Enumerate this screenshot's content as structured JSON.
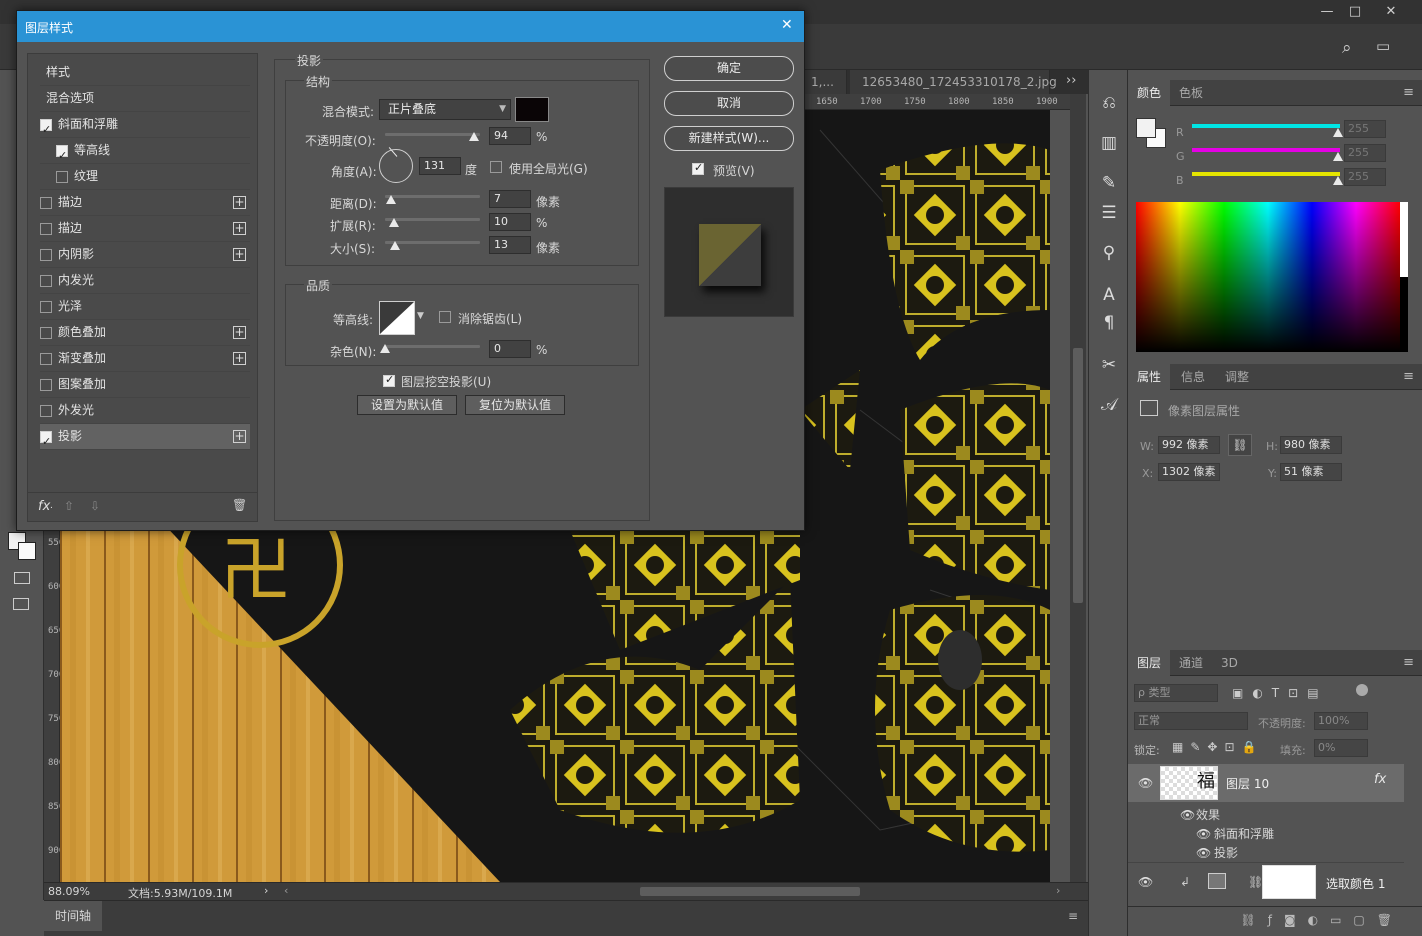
{
  "window": {
    "minimize": "—",
    "maximize": "□",
    "close": "✕",
    "search_icon": "⌕",
    "arrange_icon": "▭"
  },
  "doc": {
    "tabs": [
      "1,...",
      "12653480_172453310178_2.jpg"
    ],
    "tab_overflow": "››",
    "ruler_ticks": [
      "1650",
      "1700",
      "1750",
      "1800",
      "1850",
      "1900"
    ],
    "vruler_ticks": [
      "550",
      "600",
      "650",
      "700",
      "750",
      "800",
      "850",
      "900"
    ],
    "zoom": "88.09%",
    "doc_size": "文档:5.93M/109.1M",
    "status_arrow": "›",
    "scroll_left": "‹",
    "scroll_right": "›"
  },
  "timeline": {
    "label": "时间轴",
    "menu": "≡"
  },
  "color_panel": {
    "tabs": [
      "颜色",
      "色板"
    ],
    "menu": "≡",
    "channels": [
      {
        "name": "R",
        "value": "255",
        "color": "#00e5e5"
      },
      {
        "name": "G",
        "value": "255",
        "color": "#e500e5"
      },
      {
        "name": "B",
        "value": "255",
        "color": "#e5e500"
      }
    ]
  },
  "properties_panel": {
    "tabs": [
      "属性",
      "信息",
      "调整"
    ],
    "menu": "≡",
    "subtitle": "像素图层属性",
    "w_label": "W:",
    "w_value": "992 像素",
    "h_label": "H:",
    "h_value": "980 像素",
    "x_label": "X:",
    "x_value": "1302 像素",
    "y_label": "Y:",
    "y_value": "51 像素",
    "link_icon": "⛓"
  },
  "layers_panel": {
    "tabs": [
      "图层",
      "通道",
      "3D"
    ],
    "menu": "≡",
    "filter_label": "ρ 类型",
    "blend_mode": "正常",
    "opacity_label": "不透明度:",
    "opacity_value": "100%",
    "lock_label": "锁定:",
    "fill_label": "填充:",
    "fill_value": "0%",
    "layers": [
      {
        "name": "图层 10",
        "fx": "fx"
      },
      {
        "name": "选取颜色 1"
      }
    ],
    "effects_label": "效果",
    "effects": [
      "斜面和浮雕",
      "投影"
    ],
    "thumb_glyph": "福"
  },
  "dialog": {
    "title": "图层样式",
    "close": "✕",
    "styles": [
      {
        "label": "样式",
        "check": null,
        "plus": false,
        "indent": false
      },
      {
        "label": "混合选项",
        "check": null,
        "plus": false,
        "indent": false
      },
      {
        "label": "斜面和浮雕",
        "check": true,
        "plus": false,
        "indent": false
      },
      {
        "label": "等高线",
        "check": true,
        "plus": false,
        "indent": true
      },
      {
        "label": "纹理",
        "check": false,
        "plus": false,
        "indent": true
      },
      {
        "label": "描边",
        "check": false,
        "plus": true,
        "indent": false
      },
      {
        "label": "描边",
        "check": false,
        "plus": true,
        "indent": false
      },
      {
        "label": "内阴影",
        "check": false,
        "plus": true,
        "indent": false
      },
      {
        "label": "内发光",
        "check": false,
        "plus": false,
        "indent": false
      },
      {
        "label": "光泽",
        "check": false,
        "plus": false,
        "indent": false
      },
      {
        "label": "颜色叠加",
        "check": false,
        "plus": true,
        "indent": false
      },
      {
        "label": "渐变叠加",
        "check": false,
        "plus": true,
        "indent": false
      },
      {
        "label": "图案叠加",
        "check": false,
        "plus": false,
        "indent": false
      },
      {
        "label": "外发光",
        "check": false,
        "plus": false,
        "indent": false
      },
      {
        "label": "投影",
        "check": true,
        "plus": true,
        "indent": false
      }
    ],
    "fx_label": "fx",
    "fx_sub": ".",
    "up_arrow": "⇧",
    "down_arrow": "⇩",
    "trash_icon": "🗑",
    "section_title": "投影",
    "structure_title": "结构",
    "blend_label": "混合模式:",
    "blend_value": "正片叠底",
    "shadow_color": "#0a0506",
    "opacity_label": "不透明度(O):",
    "opacity_value": "94",
    "opacity_unit": "%",
    "opacity_level": 0.94,
    "angle_label": "角度(A):",
    "angle_value": "131",
    "angle_unit": "度",
    "global_light_label": "使用全局光(G)",
    "distance_label": "距离(D):",
    "distance_value": "7",
    "distance_unit": "像素",
    "spread_label": "扩展(R):",
    "spread_value": "10",
    "spread_unit": "%",
    "size_label": "大小(S):",
    "size_value": "13",
    "size_unit": "像素",
    "quality_title": "品质",
    "contour_label": "等高线:",
    "antialias_label": "消除锯齿(L)",
    "noise_label": "杂色(N):",
    "noise_value": "0",
    "noise_unit": "%",
    "knockout_label": "图层挖空投影(U)",
    "make_default": "设置为默认值",
    "reset_default": "复位为默认值",
    "ok": "确定",
    "cancel": "取消",
    "new_style": "新建样式(W)...",
    "preview_label": "预览(V)"
  }
}
